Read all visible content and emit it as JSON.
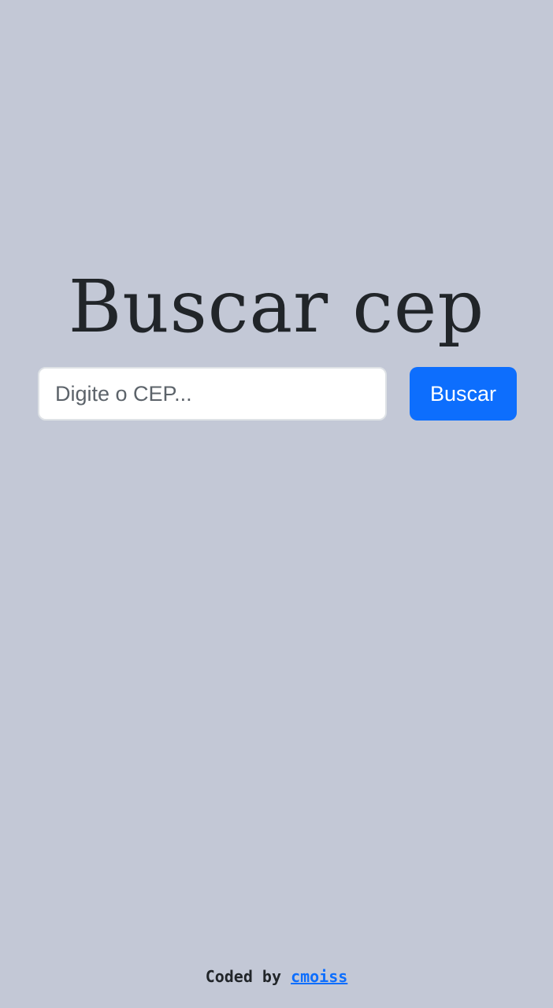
{
  "main": {
    "title": "Buscar cep",
    "search": {
      "placeholder": "Digite o CEP...",
      "value": "",
      "button_label": "Buscar"
    }
  },
  "footer": {
    "prefix": "Coded by ",
    "author_link": "cmoiss"
  },
  "colors": {
    "background": "#c3c8d6",
    "accent": "#0d6efd",
    "text": "#212529"
  }
}
